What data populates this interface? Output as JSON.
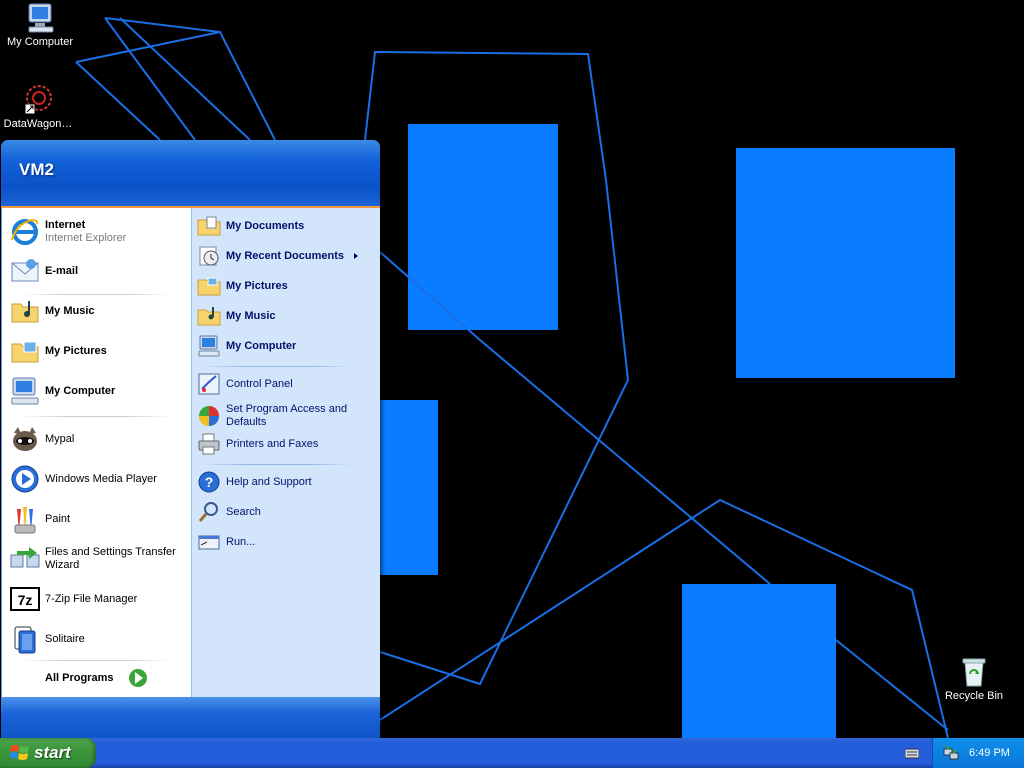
{
  "desktop": {
    "icons": [
      {
        "label": "My Computer",
        "icon": "my-computer-icon"
      },
      {
        "label": "DataWagon…",
        "icon": "datawagon-shortcut-icon"
      },
      {
        "label": "Recycle Bin",
        "icon": "recycle-bin-icon"
      }
    ],
    "wallpaper": {
      "background": "#000000",
      "accent": "#0078ff"
    }
  },
  "start_menu": {
    "user_name": "VM2",
    "pinned": [
      {
        "label": "Internet",
        "sublabel": "Internet Explorer",
        "icon": "internet-explorer-icon"
      },
      {
        "label": "E-mail",
        "icon": "email-icon"
      }
    ],
    "recent": [
      {
        "label": "My Music",
        "icon": "music-folder-icon"
      },
      {
        "label": "My Pictures",
        "icon": "pictures-folder-icon"
      },
      {
        "label": "My Computer",
        "icon": "computer-icon"
      },
      {
        "label": "Mypal",
        "icon": "mypal-icon"
      },
      {
        "label": "Windows Media Player",
        "icon": "media-player-icon"
      },
      {
        "label": "Paint",
        "icon": "paint-icon"
      },
      {
        "label": "Files and Settings Transfer\nWizard",
        "line1": "Files and Settings Transfer",
        "line2": "Wizard",
        "icon": "transfer-wizard-icon"
      },
      {
        "label": "7-Zip File Manager",
        "icon": "7zip-icon"
      },
      {
        "label": "Solitaire",
        "icon": "solitaire-icon"
      }
    ],
    "all_programs": "All Programs",
    "places": [
      {
        "label": "My Documents",
        "icon": "documents-folder-icon"
      },
      {
        "label": "My Recent Documents",
        "icon": "recent-documents-icon"
      },
      {
        "label": "My Pictures",
        "icon": "pictures-folder-icon"
      },
      {
        "label": "My Music",
        "icon": "music-folder-icon"
      },
      {
        "label": "My Computer",
        "icon": "computer-icon"
      }
    ],
    "system": [
      {
        "label": "Control Panel",
        "icon": "control-panel-icon"
      },
      {
        "line1": "Set Program Access and",
        "line2": "Defaults",
        "icon": "program-access-icon"
      },
      {
        "label": "Printers and Faxes",
        "icon": "printer-icon"
      }
    ],
    "help": [
      {
        "label": "Help and Support",
        "icon": "help-icon"
      },
      {
        "label": "Search",
        "icon": "search-icon"
      },
      {
        "label": "Run...",
        "icon": "run-icon"
      }
    ]
  },
  "taskbar": {
    "start_label": "start",
    "clock": "6:49 PM",
    "colors": {
      "taskbar": "#245edb",
      "start_button": "#3c963c",
      "tray": "#0e8ae6"
    }
  }
}
